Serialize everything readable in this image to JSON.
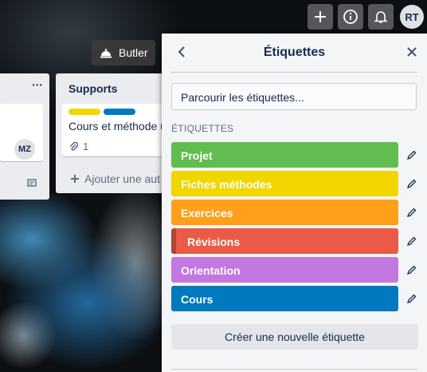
{
  "topbar": {
    "avatar_initials": "RT"
  },
  "butler": {
    "label": "Butler"
  },
  "lists": [
    {
      "title": "",
      "menu": "···",
      "avatar": "MZ"
    },
    {
      "title": "Supports",
      "card_title": "Cours et méthode ut",
      "attachments": "1",
      "add_card": "Ajouter une aut"
    }
  ],
  "panel": {
    "title": "Étiquettes",
    "search_placeholder": "Parcourir les étiquettes...",
    "section_title": "ÉTIQUETTES",
    "labels": [
      {
        "name": "Projet",
        "color": "#61bd4f"
      },
      {
        "name": "Fiches méthodes",
        "color": "#f2d600"
      },
      {
        "name": "Exercices",
        "color": "#ff9f1a"
      },
      {
        "name": "Révisions",
        "color": "#eb5a46"
      },
      {
        "name": "Orientation",
        "color": "#c377e0"
      },
      {
        "name": "Cours",
        "color": "#0079bf"
      }
    ],
    "create_label": "Créer une nouvelle étiquette"
  }
}
